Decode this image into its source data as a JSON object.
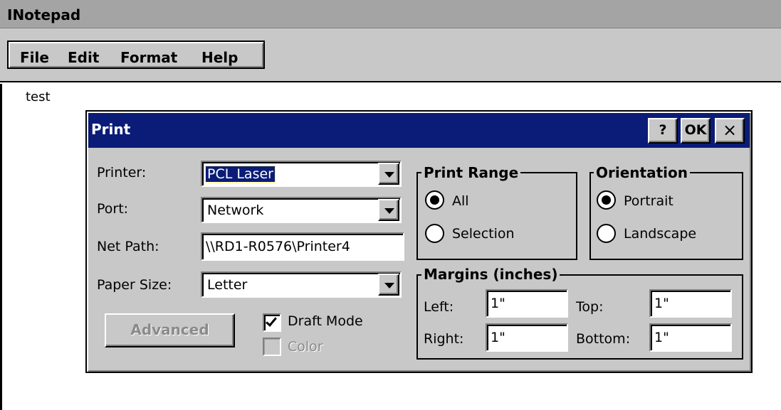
{
  "app": {
    "title": "INotepad",
    "menu": [
      "File",
      "Edit",
      "Format",
      "Help"
    ],
    "document_text": "test"
  },
  "dialog": {
    "title": "Print",
    "help_button": "?",
    "ok_button": "OK",
    "close_button": "×",
    "printer": {
      "label": "Printer:",
      "value": "PCL Laser"
    },
    "port": {
      "label": "Port:",
      "value": "Network"
    },
    "net_path": {
      "label": "Net Path:",
      "value": "\\\\RD1-R0576\\Printer4"
    },
    "paper_size": {
      "label": "Paper Size:",
      "value": "Letter"
    },
    "advanced_button": "Advanced",
    "draft_mode": {
      "label": "Draft Mode",
      "checked": true
    },
    "color": {
      "label": "Color",
      "checked": false,
      "enabled": false
    },
    "print_range": {
      "title": "Print Range",
      "options": [
        "All",
        "Selection"
      ],
      "selected": "All"
    },
    "orientation": {
      "title": "Orientation",
      "options": [
        "Portrait",
        "Landscape"
      ],
      "selected": "Portrait"
    },
    "margins": {
      "title": "Margins (inches)",
      "left": {
        "label": "Left:",
        "value": "1\""
      },
      "right": {
        "label": "Right:",
        "value": "1\""
      },
      "top": {
        "label": "Top:",
        "value": "1\""
      },
      "bottom": {
        "label": "Bottom:",
        "value": "1\""
      }
    }
  },
  "colors": {
    "titlebar_active": "#0a1c78",
    "face": "#c8c8c8",
    "app_titlebar": "#a4a4a4"
  }
}
